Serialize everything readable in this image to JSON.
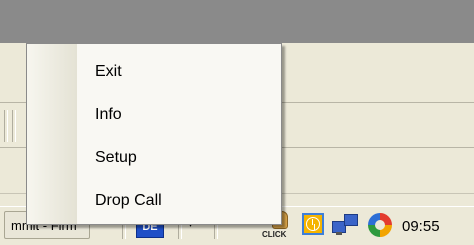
{
  "context_menu": {
    "items": [
      {
        "label": "Exit"
      },
      {
        "label": "Info"
      },
      {
        "label": "Setup"
      },
      {
        "label": "Drop Call"
      }
    ]
  },
  "taskbar": {
    "task_button_label": "mmit - Firm",
    "language_indicator": "DE",
    "language_arrow": "▾",
    "tray_chevron": "«",
    "click_icon_text": "CLICK",
    "clock": "09:55"
  },
  "colors": {
    "desktop_band": "#8a8a8a",
    "window_face": "#ece9d8",
    "language_indicator": "#1f4fc7",
    "clock_icon": "#f5b400"
  }
}
